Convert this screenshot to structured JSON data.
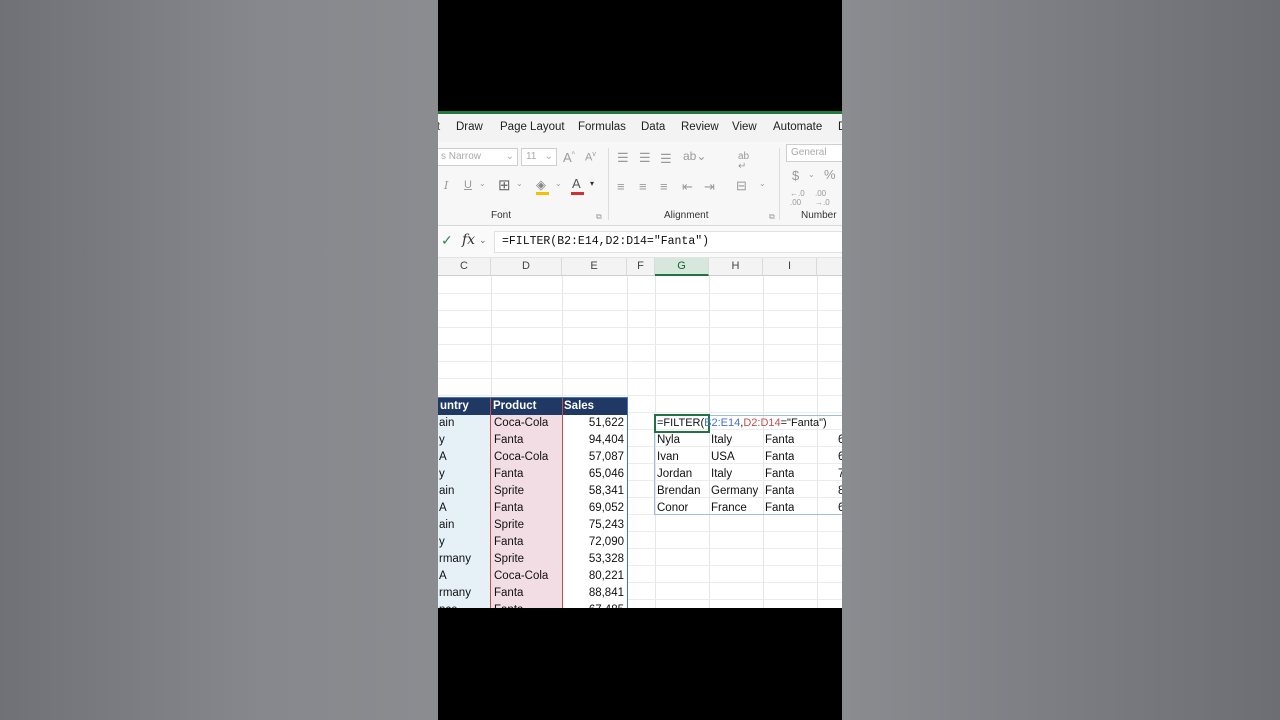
{
  "ribbon": {
    "tabs": [
      "Draw",
      "Page Layout",
      "Formulas",
      "Data",
      "Review",
      "View",
      "Automate"
    ],
    "font_name": "s Narrow",
    "font_size": "11",
    "grow_font": "A",
    "shrink_font": "A",
    "italic": "I",
    "underline": "U",
    "number_format": "General",
    "currency": "$",
    "percent": "%",
    "wrap": "ab",
    "groups": {
      "font": "Font",
      "alignment": "Alignment",
      "number": "Number"
    }
  },
  "formula_bar": {
    "check": "✓",
    "fx": "fx",
    "formula": "=FILTER(B2:E14,D2:D14=\"Fanta\")"
  },
  "grid": {
    "columns": [
      "C",
      "D",
      "E",
      "F",
      "G",
      "H",
      "I"
    ],
    "selected_column": "G",
    "headers": {
      "country": "untry",
      "product": "Product",
      "sales": "Sales"
    },
    "rows": [
      {
        "country": "ain",
        "product": "Coca-Cola",
        "sales": "51,622"
      },
      {
        "country": "y",
        "product": "Fanta",
        "sales": "94,404"
      },
      {
        "country": "A",
        "product": "Coca-Cola",
        "sales": "57,087"
      },
      {
        "country": "y",
        "product": "Fanta",
        "sales": "65,046"
      },
      {
        "country": "ain",
        "product": "Sprite",
        "sales": "58,341"
      },
      {
        "country": "A",
        "product": "Fanta",
        "sales": "69,052"
      },
      {
        "country": "ain",
        "product": "Sprite",
        "sales": "75,243"
      },
      {
        "country": "y",
        "product": "Fanta",
        "sales": "72,090"
      },
      {
        "country": "rmany",
        "product": "Sprite",
        "sales": "53,328"
      },
      {
        "country": "A",
        "product": "Coca-Cola",
        "sales": "80,221"
      },
      {
        "country": "rmany",
        "product": "Fanta",
        "sales": "88,841"
      },
      {
        "country": "nce",
        "product": "Fanta",
        "sales": "67,485"
      }
    ],
    "edit_cell": {
      "func": "=FILTER(",
      "ref1": "B2:E14",
      "comma": ",",
      "ref2": "D2:D14",
      "rest": "=\"Fanta\")"
    },
    "results": [
      {
        "name": "Nyla",
        "country": "Italy",
        "product": "Fanta",
        "sales": "6"
      },
      {
        "name": "Ivan",
        "country": "USA",
        "product": "Fanta",
        "sales": "6"
      },
      {
        "name": "Jordan",
        "country": "Italy",
        "product": "Fanta",
        "sales": "7"
      },
      {
        "name": "Brendan",
        "country": "Germany",
        "product": "Fanta",
        "sales": "8"
      },
      {
        "name": "Conor",
        "country": "France",
        "product": "Fanta",
        "sales": "6"
      }
    ]
  },
  "colors": {
    "header_fill": "#1f3864",
    "country_fill": "#e6f0f7",
    "product_fill": "#f1dde3",
    "ref_red": "#c0504d",
    "ref_blue": "#4472c4",
    "excel_green": "#217346"
  }
}
